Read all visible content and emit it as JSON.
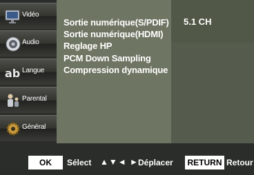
{
  "sidebar": {
    "items": [
      {
        "label": "Vidéo",
        "icon": "monitor-icon"
      },
      {
        "label": "Audio",
        "icon": "speaker-icon"
      },
      {
        "label": "Langue",
        "icon": "abc-icon"
      },
      {
        "label": "Parental",
        "icon": "family-icon"
      },
      {
        "label": "Général",
        "icon": "gear-icon"
      }
    ]
  },
  "menu": {
    "items": [
      {
        "label": "Sortie numérique(S/PDIF)"
      },
      {
        "label": "Sortie numérique(HDMI)"
      },
      {
        "label": "Reglage HP"
      },
      {
        "label": "PCM Down Sampling"
      },
      {
        "label": "Compression dynamique"
      }
    ],
    "selected_value": "5.1 CH"
  },
  "footer": {
    "ok_label": "OK",
    "select_label": "Sélect",
    "arrows": "▲▼◄ ►",
    "move_label": "Déplacer",
    "return_label": "RETURN",
    "back_label": "Retour"
  },
  "colors": {
    "background": "#2b2d2b",
    "menu_panel": "#6e7562",
    "value_panel": "#555b4d",
    "text": "#ffffff"
  }
}
